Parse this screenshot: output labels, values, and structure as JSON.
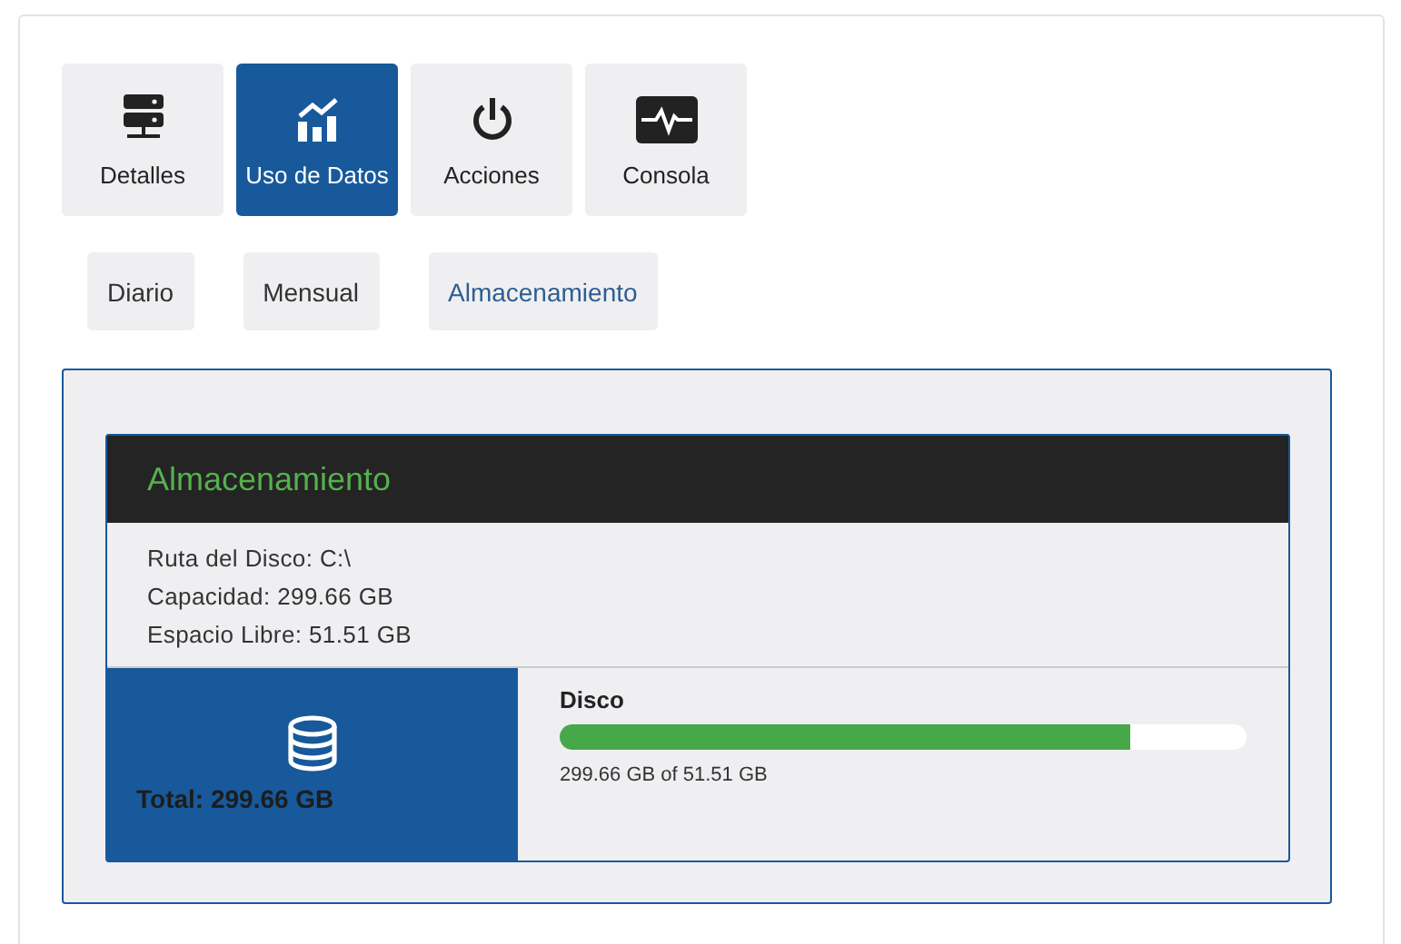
{
  "tabs": [
    {
      "label": "Detalles",
      "kind": "server",
      "selected": false
    },
    {
      "label": "Uso de Datos",
      "kind": "chart",
      "selected": true
    },
    {
      "label": "Acciones",
      "kind": "power",
      "selected": false
    },
    {
      "label": "Consola",
      "kind": "pulse",
      "selected": false
    }
  ],
  "subtabs": [
    {
      "label": "Diario",
      "selected": false
    },
    {
      "label": "Mensual",
      "selected": false
    },
    {
      "label": "Almacenamiento",
      "selected": true
    }
  ],
  "storage": {
    "title": "Almacenamiento",
    "info": [
      "Ruta del Disco: C:\\",
      "Capacidad: 299.66 GB",
      "Espacio Libre: 51.51 GB"
    ],
    "total": "Total: 299.66 GB",
    "disk": {
      "label": "Disco",
      "level": 0.83,
      "reading": "299.66 GB of 51.51 GB"
    }
  }
}
